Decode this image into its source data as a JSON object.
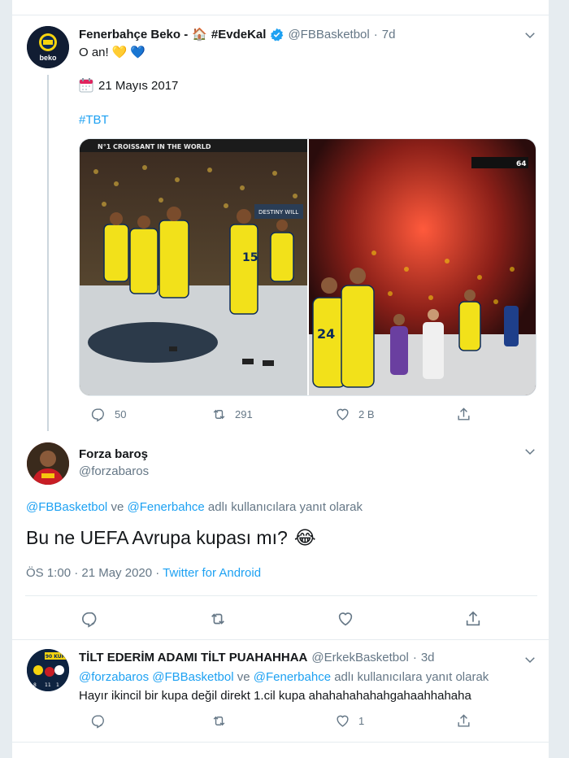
{
  "tweet1": {
    "name": "Fenerbahçe Beko -",
    "name_emoji": "🏠",
    "hashtag_name": "#EvdeKal",
    "handle": "@FBBasketbol",
    "time": "7d",
    "text": "O an!",
    "hearts": [
      "💛",
      "💙"
    ],
    "date_line": "21 Mayıs 2017",
    "hashtag": "#TBT",
    "replies": "50",
    "retweets": "291",
    "likes": "2 B",
    "photo1_banner": "N°1 CROISSANT IN THE WORLD",
    "photo1_sign": "DESTINY WILL",
    "photo2_score": "64"
  },
  "tweet2": {
    "name": "Forza baroş",
    "handle": "@forzabaros",
    "reply_prefix": "",
    "reply_to_1": "@FBBasketbol",
    "reply_mid": " ve ",
    "reply_to_2": "@Fenerbahce",
    "reply_suffix": " adlı kullanıcılara yanıt olarak",
    "text": "Bu ne UEFA Avrupa kupası mı?",
    "emoji": "😂",
    "meta_time": "ÖS 1:00 · 21 May 2020 · ",
    "client": "Twitter for Android"
  },
  "tweet3": {
    "name": "TİLT EDERİM ADAMI TİLT PUAHAHHAA",
    "handle": "@ErkekBasketbol",
    "time": "3d",
    "reply_to_1": "@forzabaros",
    "reply_to_2": "@FBBasketbol",
    "reply_mid": " ve ",
    "reply_to_3": "@Fenerbahce",
    "reply_suffix": " adlı kullanıcılara yanıt olarak",
    "text": "Hayır ikincil bir kupa değil direkt 1.cil kupa ahahahahahahgahaahhahaha",
    "likes": "1",
    "avatar_text": "90 KUPA"
  },
  "colors": {
    "accent": "#1da1f2",
    "secondary": "#657786",
    "fb_navy": "#0c2b59",
    "fb_yellow": "#f6d40e"
  }
}
